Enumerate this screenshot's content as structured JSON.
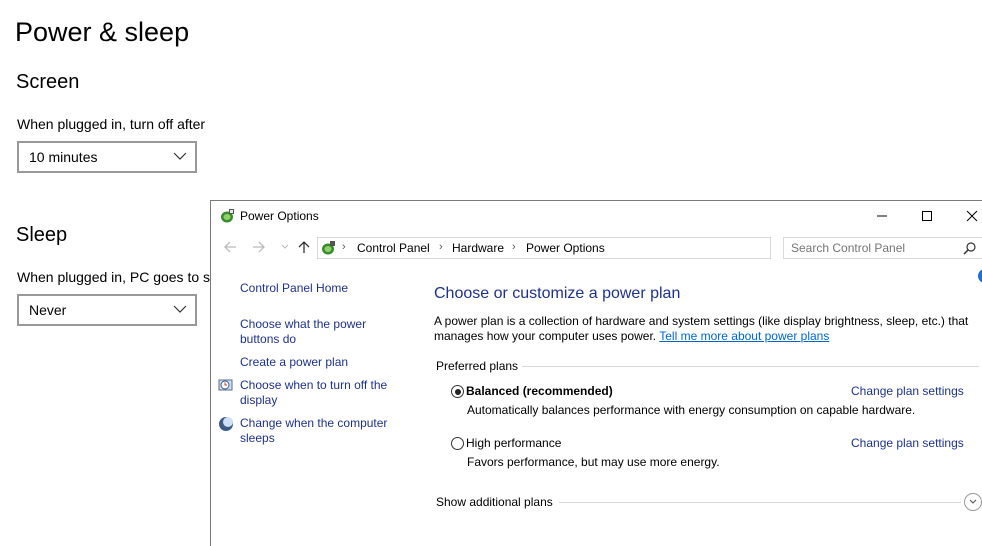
{
  "settings": {
    "page_title": "Power & sleep",
    "screen": {
      "heading": "Screen",
      "plugged_label": "When plugged in, turn off after",
      "plugged_value": "10 minutes"
    },
    "sleep": {
      "heading": "Sleep",
      "plugged_label": "When plugged in, PC goes to sl",
      "plugged_value": "Never"
    }
  },
  "window": {
    "title": "Power Options",
    "breadcrumb": [
      "Control Panel",
      "Hardware",
      "Power Options"
    ],
    "search_placeholder": "Search Control Panel",
    "left_nav": [
      {
        "label": "Control Panel Home"
      },
      {
        "label": "Choose what the power buttons do"
      },
      {
        "label": "Create a power plan"
      },
      {
        "label": "Choose when to turn off the display",
        "icon": "clock-monitor-icon"
      },
      {
        "label": "Change when the computer sleeps",
        "icon": "moon-icon"
      }
    ],
    "main": {
      "heading": "Choose or customize a power plan",
      "description": "A power plan is a collection of hardware and system settings (like display brightness, sleep, etc.) that manages how your computer uses power.",
      "learn_more_link": "Tell me more about power plans",
      "preferred_heading": "Preferred plans",
      "plans": [
        {
          "name": "Balanced (recommended)",
          "description": "Automatically balances performance with energy consumption on capable hardware.",
          "link": "Change plan settings",
          "selected": true
        },
        {
          "name": "High performance",
          "description": "Favors performance, but may use more energy.",
          "link": "Change plan settings",
          "selected": false
        }
      ],
      "show_additional": "Show additional plans"
    }
  },
  "colors": {
    "link": "#1e3287",
    "hyperlink": "#0066cc",
    "help_accent": "#1f6fd6"
  }
}
